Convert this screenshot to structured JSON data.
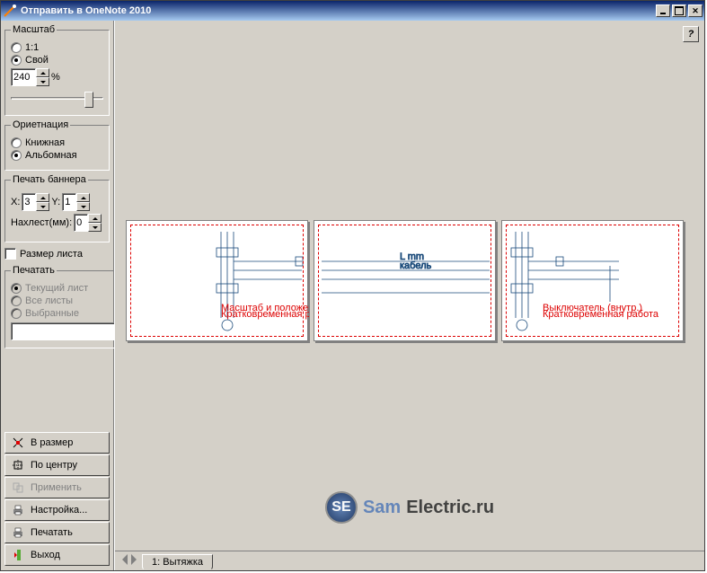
{
  "window": {
    "title": "Отправить в OneNote 2010"
  },
  "sidebar": {
    "scale": {
      "legend": "Масштаб",
      "opt_11": "1:1",
      "opt_custom": "Свой",
      "value": "240",
      "percent": "%"
    },
    "orientation": {
      "legend": "Ориетнация",
      "portrait": "Книжная",
      "landscape": "Альбомная"
    },
    "banner": {
      "legend": "Печать баннера",
      "x_label": "X:",
      "x_value": "3",
      "y_label": "Y:",
      "y_value": "1",
      "overlap_label": "Нахлест(мм):",
      "overlap_value": "0"
    },
    "sheet_size": "Размер листа",
    "print": {
      "legend": "Печатать",
      "current": "Текущий лист",
      "all": "Все листы",
      "selected": "Выбранные",
      "path": ""
    },
    "buttons": {
      "fit": "В размер",
      "center": "По центру",
      "apply": "Применить",
      "settings": "Настройка...",
      "print_btn": "Печатать",
      "exit": "Выход"
    }
  },
  "tab": {
    "label": "1: Вытяжка"
  },
  "watermark": {
    "brand1": "Sam",
    "brand2": "Electric.ru",
    "logo": "SE"
  },
  "help": "?"
}
